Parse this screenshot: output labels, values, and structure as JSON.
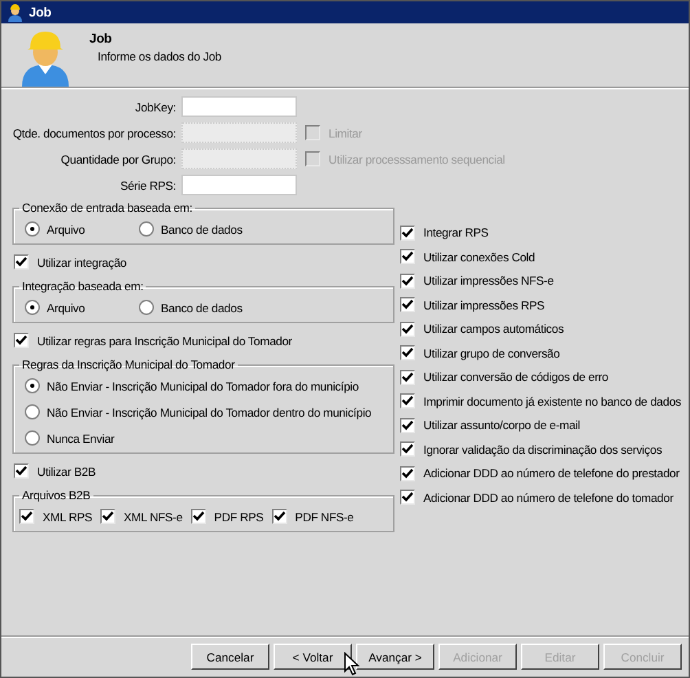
{
  "window": {
    "title": "Job"
  },
  "header": {
    "title": "Job",
    "subtitle": "Informe os dados do Job"
  },
  "fields": [
    {
      "label": "JobKey:",
      "disabled": false
    },
    {
      "label": "Qtde. documentos por processo:",
      "disabled": true,
      "option": {
        "label": "Limitar",
        "checked": false,
        "disabled": true
      }
    },
    {
      "label": "Quantidade por Grupo:",
      "disabled": true,
      "option": {
        "label": "Utilizar processsamento sequencial",
        "checked": false,
        "disabled": true
      }
    },
    {
      "label": "Série RPS:",
      "disabled": false
    }
  ],
  "left": [
    {
      "kind": "radio-group",
      "title": "Conexão de entrada baseada em:",
      "options": [
        {
          "label": "Arquivo",
          "selected": true
        },
        {
          "label": "Banco de dados",
          "selected": false
        }
      ]
    },
    {
      "kind": "checkbox",
      "label": "Utilizar integração",
      "checked": true
    },
    {
      "kind": "radio-group",
      "title": "Integração baseada em:",
      "options": [
        {
          "label": "Arquivo",
          "selected": true
        },
        {
          "label": "Banco de dados",
          "selected": false
        }
      ]
    },
    {
      "kind": "checkbox",
      "label": "Utilizar regras para Inscrição Municipal do Tomador",
      "checked": true
    },
    {
      "kind": "radio-group",
      "title": "Regras da Inscrição Municipal do Tomador",
      "options": [
        {
          "label": "Não Enviar - Inscrição Municipal do Tomador fora do município",
          "selected": true
        },
        {
          "label": "Não Enviar - Inscrição Municipal do Tomador dentro do município",
          "selected": false
        },
        {
          "label": "Nunca Enviar",
          "selected": false
        }
      ]
    },
    {
      "kind": "checkbox",
      "label": "Utilizar B2B",
      "checked": true
    },
    {
      "kind": "checkbox-group",
      "title": "Arquivos B2B",
      "options": [
        {
          "label": "XML RPS",
          "checked": true
        },
        {
          "label": "XML NFS-e",
          "checked": true
        },
        {
          "label": "PDF RPS",
          "checked": true
        },
        {
          "label": "PDF NFS-e",
          "checked": true
        }
      ]
    }
  ],
  "right": [
    {
      "label": "Integrar RPS",
      "checked": true
    },
    {
      "label": "Utilizar conexões Cold",
      "checked": true
    },
    {
      "label": "Utilizar impressões NFS-e",
      "checked": true
    },
    {
      "label": "Utilizar impressões RPS",
      "checked": true
    },
    {
      "label": "Utilizar campos automáticos",
      "checked": true
    },
    {
      "label": "Utilizar grupo de conversão",
      "checked": true
    },
    {
      "label": "Utilizar conversão de códigos de erro",
      "checked": true
    },
    {
      "label": "Imprimir documento já existente no banco de dados",
      "checked": true
    },
    {
      "label": "Utilizar assunto/corpo de e-mail",
      "checked": true
    },
    {
      "label": "Ignorar validação da discriminação dos serviços",
      "checked": true
    },
    {
      "label": "Adicionar DDD ao número de telefone do prestador",
      "checked": true
    },
    {
      "label": "Adicionar DDD ao número de telefone do tomador",
      "checked": true
    }
  ],
  "buttons": [
    {
      "label": "Cancelar",
      "disabled": false
    },
    {
      "label": "< Voltar",
      "disabled": false
    },
    {
      "label": "Avançar >",
      "disabled": false
    },
    {
      "label": "Adicionar",
      "disabled": true
    },
    {
      "label": "Editar",
      "disabled": true
    },
    {
      "label": "Concluir",
      "disabled": true
    }
  ]
}
